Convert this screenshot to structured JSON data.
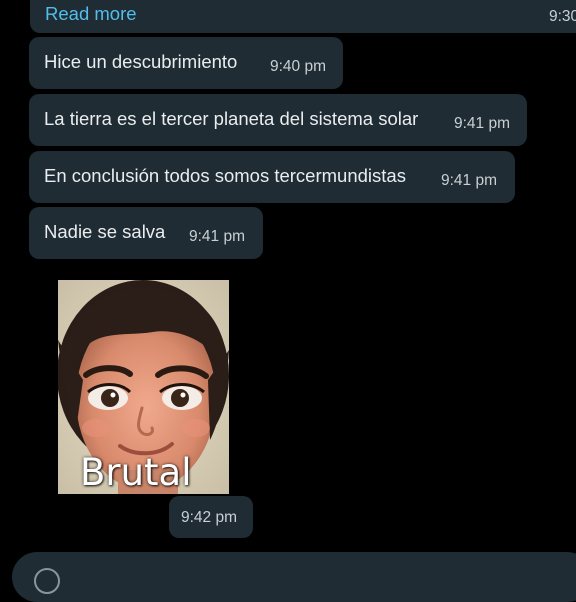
{
  "messages": [
    {
      "link": "Read more",
      "time": "9:30"
    },
    {
      "text": "Hice un descubrimiento",
      "time": "9:40 pm"
    },
    {
      "text": "La tierra es el tercer planeta del sistema solar",
      "time": "9:41 pm"
    },
    {
      "text": "En conclusión todos somos tercermundistas",
      "time": "9:41 pm"
    },
    {
      "text": "Nadie se salva",
      "time": "9:41 pm"
    },
    {
      "sticker_caption": "Brutal",
      "time": "9:42 pm"
    }
  ],
  "colors": {
    "background": "#000000",
    "bubble": "#1f2c33",
    "link": "#53bdeb",
    "text": "#e9edef",
    "timestamp": "#c9d0d3"
  },
  "icons": {
    "input_bar": "emoji-icon"
  }
}
